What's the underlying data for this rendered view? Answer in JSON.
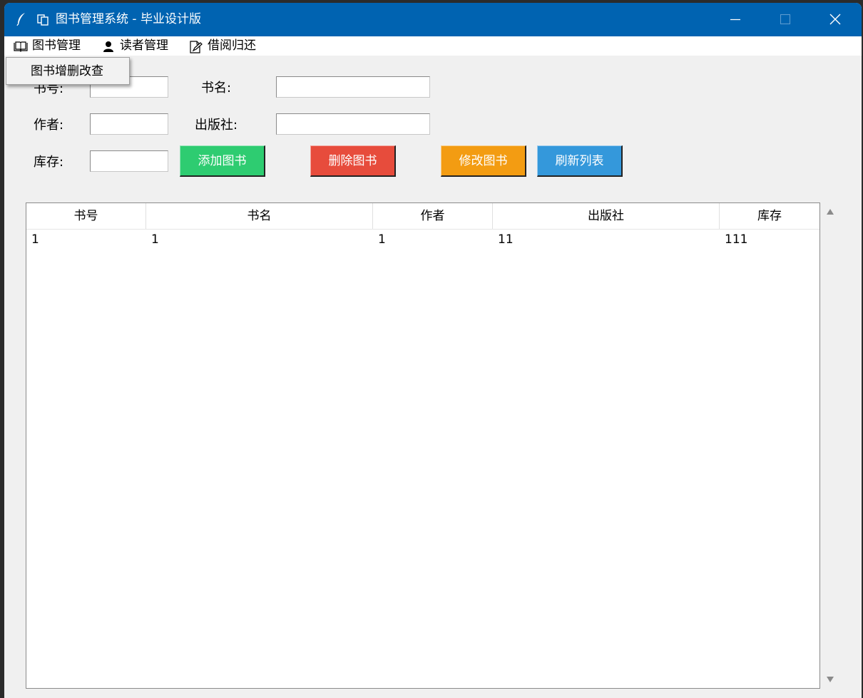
{
  "window": {
    "title": "图书管理系统 - 毕业设计版"
  },
  "menu": {
    "items": [
      {
        "label": "图书管理",
        "icon": "book-icon"
      },
      {
        "label": "读者管理",
        "icon": "user-icon"
      },
      {
        "label": "借阅归还",
        "icon": "edit-document-icon"
      }
    ],
    "dropdown": [
      "图书增删改查"
    ]
  },
  "form": {
    "book_id_label": "书号:",
    "title_label": "书名:",
    "author_label": "作者:",
    "publisher_label": "出版社:",
    "stock_label": "库存:",
    "book_id_value": "",
    "title_value": "",
    "author_value": "",
    "publisher_value": "",
    "stock_value": ""
  },
  "buttons": {
    "add": {
      "label": "添加图书",
      "color": "#2ecc71"
    },
    "delete": {
      "label": "删除图书",
      "color": "#e74c3c"
    },
    "edit": {
      "label": "修改图书",
      "color": "#f39c12"
    },
    "refresh": {
      "label": "刷新列表",
      "color": "#3498db"
    }
  },
  "table": {
    "columns": [
      "书号",
      "书名",
      "作者",
      "出版社",
      "库存"
    ],
    "rows": [
      [
        "1",
        "1",
        "1",
        "11",
        "111"
      ]
    ]
  },
  "colors": {
    "titlebar": "#0063b1",
    "window_bg": "#f0f0f0"
  }
}
